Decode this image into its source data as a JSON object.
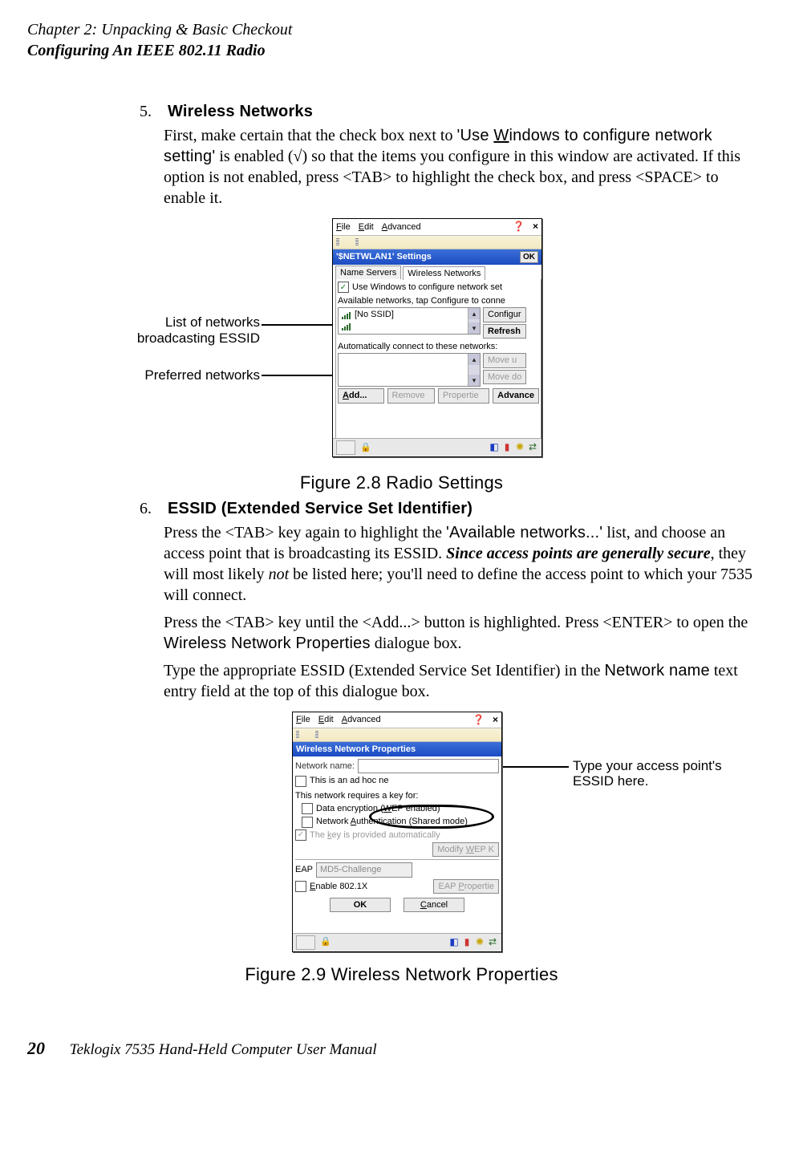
{
  "header": {
    "chapter": "Chapter  2:  Unpacking & Basic Checkout",
    "section": "Configuring An IEEE 802.11 Radio"
  },
  "step5": {
    "num": "5.",
    "title": "Wireless Networks",
    "body_pre": "First, make certain that the check box next to ",
    "body_q1a": "'Use ",
    "body_q1b_u": "W",
    "body_q1b": "indows to configure network setting'",
    "body_mid": " is enabled (√) so that the items you configure in this window are activated. If this option is not enabled, press <TAB> to highlight the check box, and press <SPACE> to enable it."
  },
  "fig28": {
    "caption": "Figure 2.8 Radio Settings",
    "annotation1a": "List of networks",
    "annotation1b": "broadcasting ESSID",
    "annotation2": "Preferred networks",
    "menu": {
      "file_u": "F",
      "file": "ile",
      "edit_u": "E",
      "edit": "dit",
      "adv_u": "A",
      "adv": "dvanced"
    },
    "title": "'$NETWLAN1' Settings",
    "ok": "OK",
    "tab1": "Name Servers",
    "tab2": "Wireless Networks",
    "check_label": "Use Windows to configure network set",
    "avail_label": "Available networks, tap Configure to conne",
    "list_item": "[No SSID]",
    "btn_configure": "Configur",
    "btn_refresh": "Refresh",
    "auto_label": "Automatically connect to these networks:",
    "btn_moveup": "Move u",
    "btn_movedn": "Move do",
    "btn_add_u": "A",
    "btn_add": "dd...",
    "btn_remove": "Remove",
    "btn_props": "Propertie",
    "btn_adv": "Advance"
  },
  "step6": {
    "num": "6.",
    "title": "ESSID (Extended Service Set Identifier)",
    "p1a": "Press the <TAB> key again to highlight the ",
    "p1b": "'Available networks...'",
    "p1c": " list, and choose an access point that is broadcasting its ESSID. ",
    "p1d": "Since access points are generally secure",
    "p1e": ", they will most likely ",
    "p1f": "not",
    "p1g": " be listed here; you'll need to define the access point to which your 7535 will connect.",
    "p2a": "Press the <TAB> key until the <Add...> button is highlighted. Press <ENTER> to open the ",
    "p2b": "Wireless Network Properties",
    "p2c": " dialogue box.",
    "p3a": "Type the appropriate ESSID (Extended Service Set Identifier) in the ",
    "p3b": "Network name",
    "p3c": " text entry field at the top of this dialogue box."
  },
  "fig29": {
    "caption": "Figure 2.9 Wireless Network Properties",
    "anno_a": "Type your access point's",
    "anno_b": "ESSID here.",
    "menu": {
      "file_u": "F",
      "file": "ile",
      "edit_u": "E",
      "edit": "dit",
      "adv_u": "A",
      "adv": "dvanced"
    },
    "title": "Wireless Network Properties",
    "netname_label": "Network name:",
    "adhoc_label": "This is an ad hoc ne",
    "keyfor_label": "This network requires a key for:",
    "wep_label_pre": "Data encryption (",
    "wep_u": "W",
    "wep_label_post": "EP enabled)",
    "auth_label_pre": "Network ",
    "auth_u": "A",
    "auth_label_post": "uthentication (Shared mode)",
    "keyauto_pre": "The ",
    "keyauto_u": "k",
    "keyauto_post": "ey is provided automatically",
    "modify_btn_pre": "Modify ",
    "modify_u": "W",
    "modify_btn_post": "EP K",
    "eap_label": "EAP",
    "eap_value": "MD5-Challenge",
    "enable_pre": "",
    "enable_u": "E",
    "enable_post": "nable 802.1X",
    "eap_props_pre": "EAP ",
    "eap_props_u": "P",
    "eap_props_post": "ropertie",
    "ok": "OK",
    "cancel_u": "C",
    "cancel": "ancel"
  },
  "footer": {
    "pagenum": "20",
    "text": "Teklogix 7535 Hand-Held Computer User Manual"
  }
}
